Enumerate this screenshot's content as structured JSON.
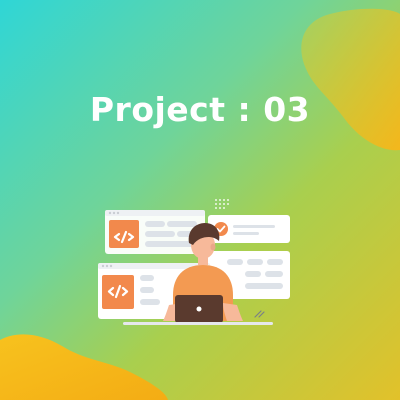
{
  "title": "Project : 03",
  "colors": {
    "background_start": "#2fd6d6",
    "background_end": "#e2c12a",
    "blob": "#f2b81a",
    "code_badge": "#f2894c",
    "shirt": "#f39a52",
    "laptop": "#5a3a2e",
    "card": "#ffffff",
    "placeholder": "#dde2e8"
  },
  "illustration": {
    "description_icons": [
      "code-icon",
      "code-icon",
      "check-circle-icon",
      "dot-grid-icon",
      "laptop-icon"
    ]
  }
}
